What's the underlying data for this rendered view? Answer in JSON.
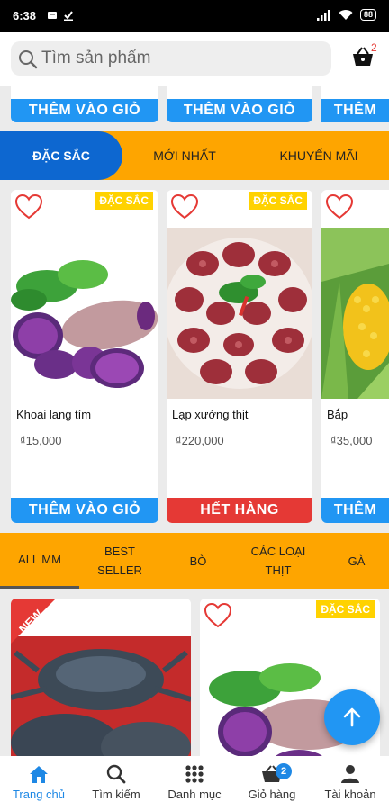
{
  "status_bar": {
    "time": "6:38",
    "battery": "88"
  },
  "search": {
    "placeholder": "Tìm sản phẩm"
  },
  "cart": {
    "count": "2"
  },
  "top_row": {
    "buttons": [
      "THÊM VÀO GIỎ",
      "THÊM VÀO GIỎ",
      "THÊM"
    ]
  },
  "category_tabs": [
    "ĐẶC SẮC",
    "MỚI NHẤT",
    "KHUYẾN MÃI"
  ],
  "featured": [
    {
      "badge": "ĐẶC SẮC",
      "name": "Khoai lang tím",
      "price": "₫15,000",
      "action": "THÊM VÀO GIỎ"
    },
    {
      "badge": "ĐẶC SẮC",
      "name": "Lạp xưởng thịt",
      "price": "₫220,000",
      "action": "HẾT HÀNG"
    },
    {
      "badge": "",
      "name": "Bắp",
      "price": "₫35,000",
      "action": "THÊM"
    }
  ],
  "filter_tabs": [
    "ALL MM",
    "BEST SELLER",
    "BÒ",
    "CÁC LOẠI THỊT",
    "GÀ"
  ],
  "listing": [
    {
      "corner": "NEW"
    },
    {
      "badge": "ĐẶC SẮC"
    }
  ],
  "bottom_nav": [
    {
      "label": "Trang chủ"
    },
    {
      "label": "Tìm kiếm"
    },
    {
      "label": "Danh mục"
    },
    {
      "label": "Giỏ hàng",
      "count": "2"
    },
    {
      "label": "Tài khoản"
    }
  ],
  "colors": {
    "accent": "#2196f3",
    "tab_bg": "#fea500",
    "active_tab": "#0d67d0",
    "sold_out": "#e53935",
    "badge": "#ffd200"
  }
}
